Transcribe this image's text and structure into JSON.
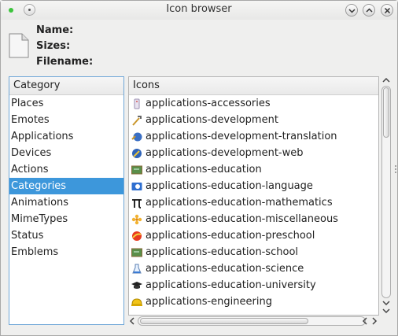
{
  "window": {
    "title": "Icon browser"
  },
  "info": {
    "name_label": "Name:",
    "sizes_label": "Sizes:",
    "filename_label": "Filename:"
  },
  "category_panel": {
    "header": "Category",
    "items": [
      {
        "label": "Places",
        "selected": false
      },
      {
        "label": "Emotes",
        "selected": false
      },
      {
        "label": "Applications",
        "selected": false
      },
      {
        "label": "Devices",
        "selected": false
      },
      {
        "label": "Actions",
        "selected": false
      },
      {
        "label": "Categories",
        "selected": true
      },
      {
        "label": "Animations",
        "selected": false
      },
      {
        "label": "MimeTypes",
        "selected": false
      },
      {
        "label": "Status",
        "selected": false
      },
      {
        "label": "Emblems",
        "selected": false
      }
    ]
  },
  "icons_panel": {
    "header": "Icons",
    "items": [
      {
        "label": "applications-accessories",
        "icon": "accessories-icon"
      },
      {
        "label": "applications-development",
        "icon": "development-icon"
      },
      {
        "label": "applications-development-translation",
        "icon": "translation-icon"
      },
      {
        "label": "applications-development-web",
        "icon": "web-globe-icon"
      },
      {
        "label": "applications-education",
        "icon": "chalkboard-icon"
      },
      {
        "label": "applications-education-language",
        "icon": "language-icon"
      },
      {
        "label": "applications-education-mathematics",
        "icon": "pi-icon"
      },
      {
        "label": "applications-education-miscellaneous",
        "icon": "flower-icon"
      },
      {
        "label": "applications-education-preschool",
        "icon": "ball-icon"
      },
      {
        "label": "applications-education-school",
        "icon": "chalkboard-icon"
      },
      {
        "label": "applications-education-science",
        "icon": "flask-icon"
      },
      {
        "label": "applications-education-university",
        "icon": "graduation-cap-icon"
      },
      {
        "label": "applications-engineering",
        "icon": "hardhat-icon"
      }
    ]
  },
  "colors": {
    "selection": "#3d97db",
    "focus_border": "#6fa7d8"
  }
}
